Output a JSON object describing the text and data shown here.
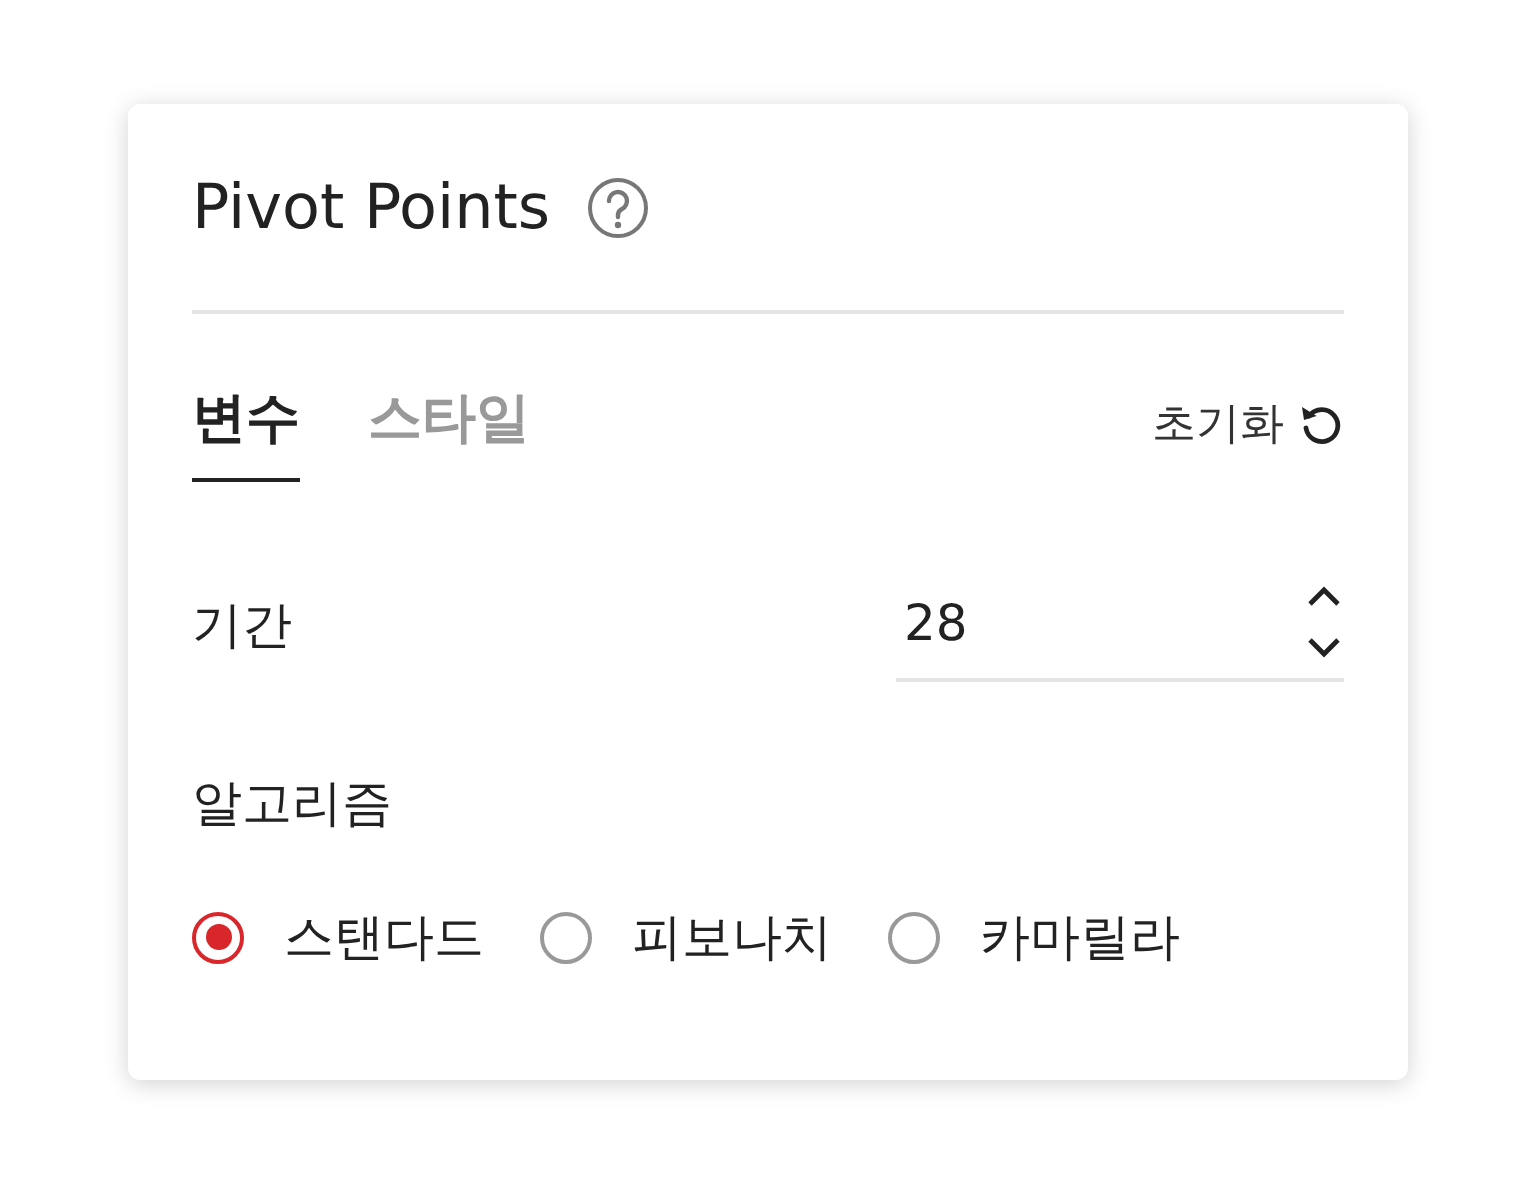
{
  "panel": {
    "title": "Pivot Points",
    "tabs": [
      {
        "label": "변수",
        "selected": true
      },
      {
        "label": "스타일",
        "selected": false
      }
    ],
    "reset_label": "초기화",
    "period": {
      "label": "기간",
      "value": "28"
    },
    "algorithm": {
      "label": "알고리즘",
      "options": [
        {
          "label": "스탠다드",
          "selected": true
        },
        {
          "label": "피보나치",
          "selected": false
        },
        {
          "label": "카마릴라",
          "selected": false
        }
      ]
    }
  }
}
